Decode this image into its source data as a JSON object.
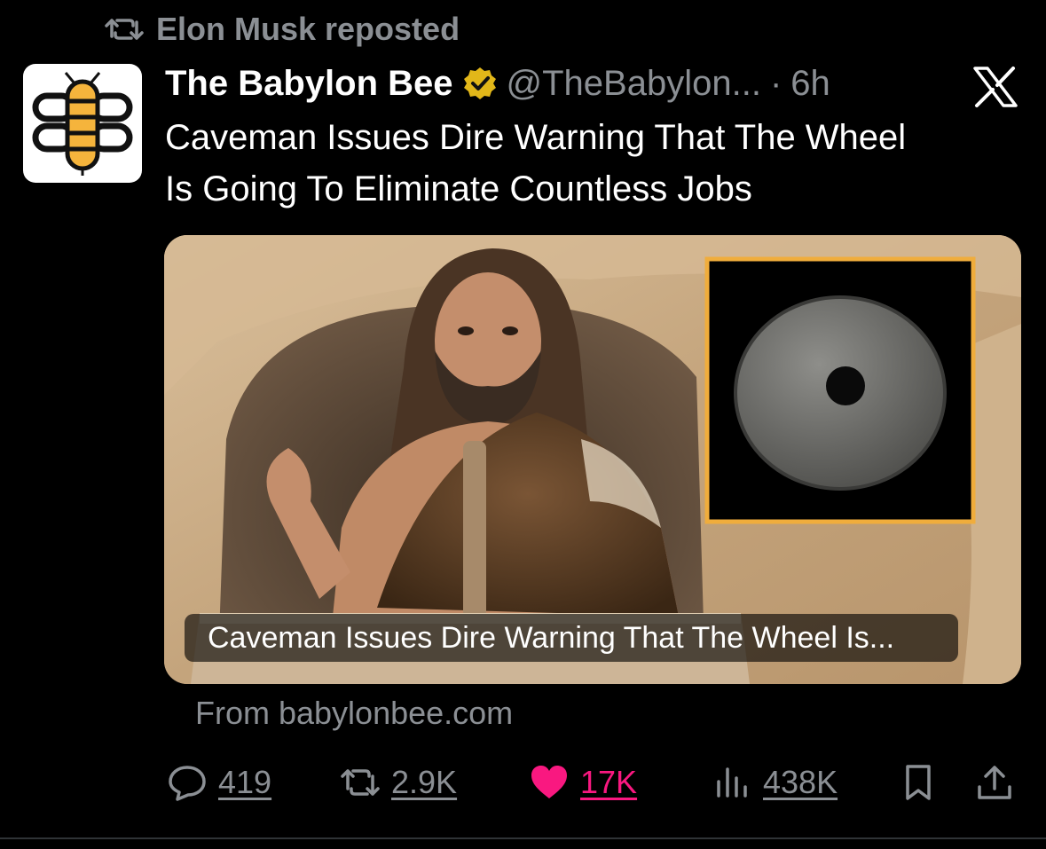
{
  "repost": {
    "label": "Elon Musk reposted"
  },
  "post": {
    "display_name": "The Babylon Bee",
    "handle": "@TheBabylon...",
    "separator": "·",
    "time": "6h",
    "text_line1": "Caveman Issues Dire Warning That The Wheel",
    "text_line2": "Is Going To Eliminate Countless Jobs"
  },
  "card": {
    "title": "Caveman Issues Dire Warning That The Wheel Is...",
    "source": "From babylonbee.com"
  },
  "actions": {
    "replies": "419",
    "reposts": "2.9K",
    "likes": "17K",
    "views": "438K"
  },
  "colors": {
    "background": "#000000",
    "muted": "#8b8f94",
    "like": "#f91880",
    "verified_gold": "#e2b719",
    "bee_yellow": "#f5b43c"
  },
  "icons": [
    "repost-icon",
    "verified-badge-icon",
    "x-logo-icon",
    "reply-icon",
    "heart-icon",
    "views-icon",
    "bookmark-icon",
    "share-icon"
  ]
}
